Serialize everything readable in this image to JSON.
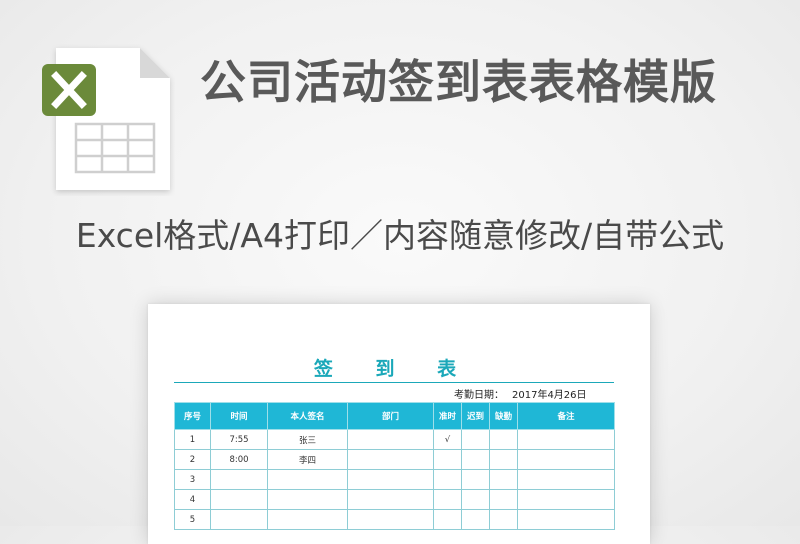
{
  "header": {
    "title": "公司活动签到表表格模版",
    "subtitle": "Excel格式/A4打印／内容随意修改/自带公式"
  },
  "icon": {
    "name": "excel-file-icon",
    "badge_color": "#6b8a3a"
  },
  "document": {
    "title": "签 到 表",
    "date_label": "考勤日期：",
    "date_value": "2017年4月26日",
    "accent_color": "#1fb7d6",
    "columns": [
      "序号",
      "时间",
      "本人签名",
      "部门",
      "准时",
      "迟到",
      "缺勤",
      "备注"
    ],
    "rows": [
      [
        "1",
        "7:55",
        "张三",
        "",
        "√",
        "",
        "",
        ""
      ],
      [
        "2",
        "8:00",
        "李四",
        "",
        "",
        "",
        "",
        ""
      ],
      [
        "3",
        "",
        "",
        "",
        "",
        "",
        "",
        ""
      ],
      [
        "4",
        "",
        "",
        "",
        "",
        "",
        "",
        ""
      ],
      [
        "5",
        "",
        "",
        "",
        "",
        "",
        "",
        ""
      ]
    ]
  }
}
